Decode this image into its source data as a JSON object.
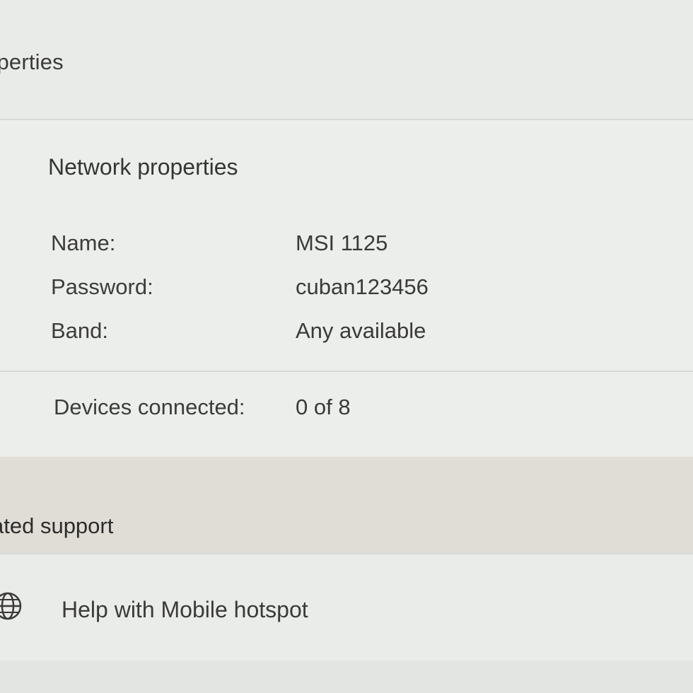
{
  "header": {
    "title": "operties"
  },
  "network_properties": {
    "title": "Network properties",
    "rows": [
      {
        "label": "Name:",
        "value": "MSI 1125"
      },
      {
        "label": "Password:",
        "value": "cuban123456"
      },
      {
        "label": "Band:",
        "value": "Any available"
      }
    ],
    "devices": {
      "label": "Devices connected:",
      "value": "0 of 8"
    }
  },
  "related_support": {
    "title": "ated support",
    "help_link": {
      "icon": "globe-icon",
      "label": "Help with Mobile hotspot"
    }
  }
}
